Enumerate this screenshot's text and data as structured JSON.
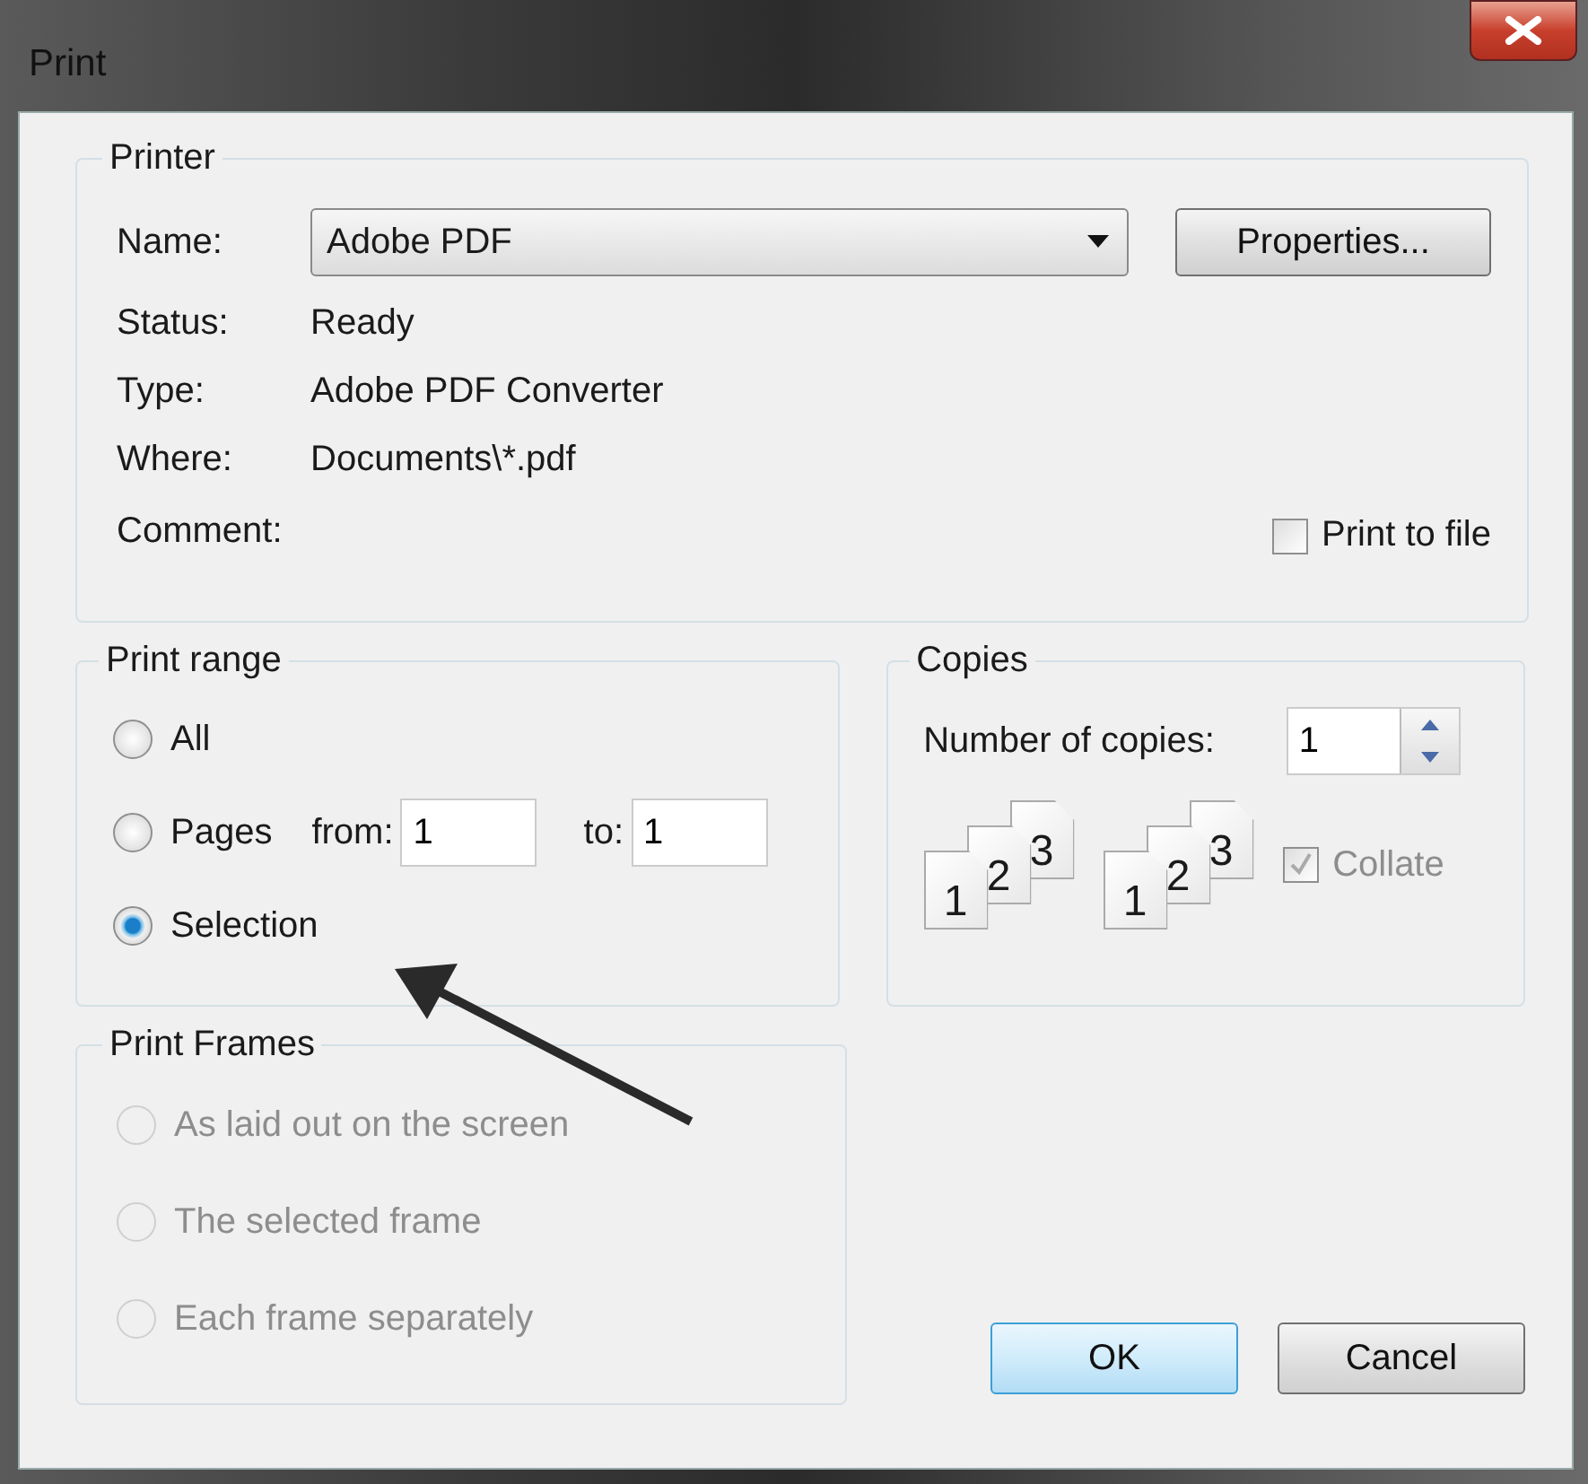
{
  "window": {
    "title": "Print"
  },
  "printer": {
    "title": "Printer",
    "name_label": "Name:",
    "name_value": "Adobe PDF",
    "properties_button": "Properties...",
    "info": [
      {
        "label": "Status:",
        "value": "Ready"
      },
      {
        "label": "Type:",
        "value": "Adobe PDF Converter"
      },
      {
        "label": "Where:",
        "value": "Documents\\*.pdf"
      },
      {
        "label": "Comment:"
      }
    ],
    "print_to_file": {
      "label": "Print to file",
      "checked": false
    }
  },
  "print_range": {
    "title": "Print range",
    "options": [
      {
        "label": "All",
        "selected": false
      },
      {
        "label": "Pages",
        "selected": false
      },
      {
        "label": "Selection",
        "selected": true
      }
    ],
    "from_label": "from:",
    "from_value": "1",
    "to_label": "to:",
    "to_value": "1"
  },
  "copies": {
    "title": "Copies",
    "number_label": "Number of copies:",
    "number_value": "1",
    "collate_icons": [
      {
        "pages": [
          "1",
          "2",
          "3"
        ]
      },
      {
        "pages": [
          "1",
          "2",
          "3"
        ]
      }
    ],
    "collate": {
      "label": "Collate",
      "checked": true,
      "disabled": true
    }
  },
  "print_frames": {
    "title": "Print Frames",
    "disabled": true,
    "options": [
      {
        "label": "As laid out on the screen",
        "selected": false
      },
      {
        "label": "The selected frame",
        "selected": false
      },
      {
        "label": "Each frame separately",
        "selected": false
      }
    ]
  },
  "buttons": [
    {
      "label": "OK",
      "default": true
    },
    {
      "label": "Cancel",
      "default": false
    }
  ]
}
